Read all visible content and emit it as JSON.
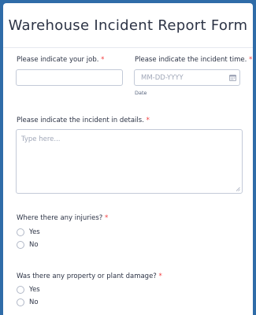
{
  "form": {
    "title": "Warehouse Incident Report Form"
  },
  "fields": {
    "job": {
      "label": "Please indicate your job.",
      "required": "*",
      "value": ""
    },
    "time": {
      "label": "Please indicate the incident time.",
      "required": "*",
      "placeholder": "MM-DD-YYYY",
      "sublabel": "Date",
      "icon": "calendar-icon"
    },
    "details": {
      "label": "Please indicate the incident in details.",
      "required": "*",
      "placeholder": "Type here..."
    },
    "injuries": {
      "label": "Where there any injuries?",
      "required": "*",
      "options": [
        "Yes",
        "No"
      ]
    },
    "damage": {
      "label": "Was there any property or plant damage?",
      "required": "*",
      "options": [
        "Yes",
        "No"
      ]
    }
  },
  "colors": {
    "background": "#2f6ca8",
    "required": "#f23a3c",
    "text": "#2c3345",
    "border": "#c3cad8"
  }
}
